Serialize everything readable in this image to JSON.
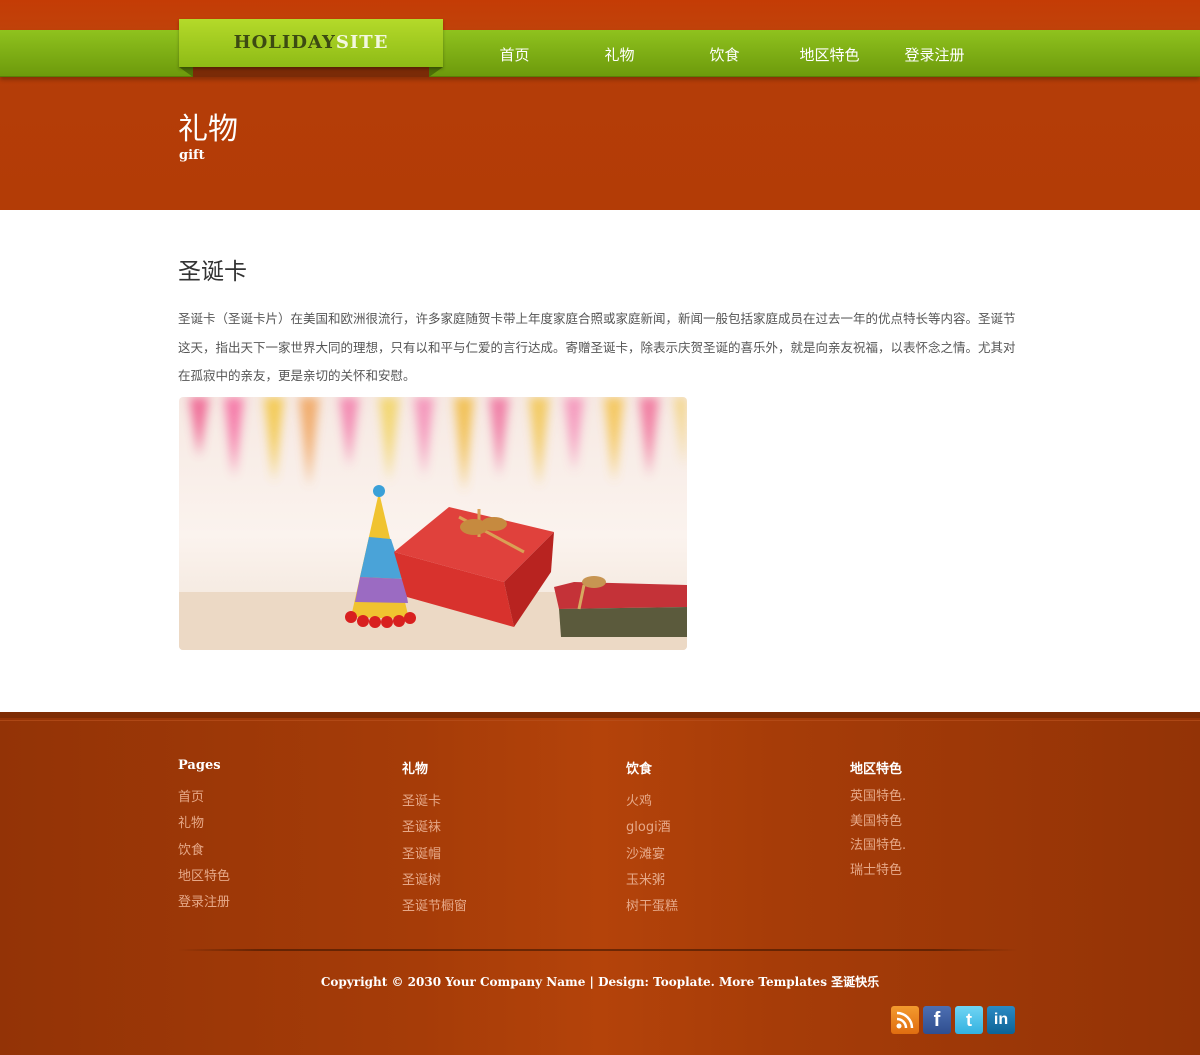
{
  "header": {
    "logo_part1": "HOLIDAY",
    "logo_part2": "SITE",
    "nav": [
      "首页",
      "礼物",
      "饮食",
      "地区特色",
      "登录注册"
    ],
    "page_title": "礼物",
    "page_subtitle": "gift"
  },
  "article": {
    "title": "圣诞卡",
    "body": "圣诞卡（圣诞卡片）在美国和欧洲很流行，许多家庭随贺卡带上年度家庭合照或家庭新闻，新闻一般包括家庭成员在过去一年的优点特长等内容。圣诞节这天，指出天下一家世界大同的理想，只有以和平与仁爱的言行达成。寄赠圣诞卡，除表示庆贺圣诞的喜乐外，就是向亲友祝福，以表怀念之情。尤其对在孤寂中的亲友，更是亲切的关怀和安慰。"
  },
  "footer": {
    "columns": [
      {
        "title": "Pages",
        "links": [
          "首页",
          "礼物",
          "饮食",
          "地区特色",
          "登录注册"
        ]
      },
      {
        "title": "礼物",
        "links": [
          "圣诞卡",
          "圣诞袜",
          "圣诞帽",
          "圣诞树",
          "圣诞节橱窗"
        ]
      },
      {
        "title": "饮食",
        "links": [
          "火鸡",
          "glogi酒",
          "沙滩宴",
          "玉米粥",
          "树干蛋糕"
        ]
      },
      {
        "title": "地区特色",
        "links": [
          "英国特色.",
          "美国特色",
          "法国特色.",
          "瑞士特色"
        ]
      }
    ],
    "copyright": "Copyright © 2030 Your Company Name | Design: Tooplate. More Templates 圣诞快乐",
    "social_icons": [
      "rss-icon",
      "facebook-icon",
      "twitter-icon",
      "linkedin-icon"
    ]
  },
  "colors": {
    "header_orange": "#c0420a",
    "nav_green": "#7fae16",
    "footer_brown": "#a63c08",
    "link_color": "#e6a888"
  }
}
